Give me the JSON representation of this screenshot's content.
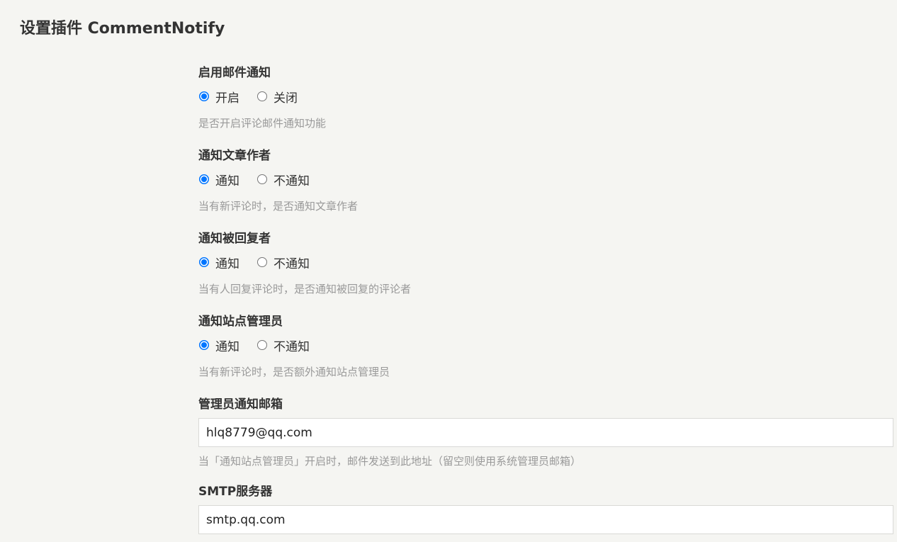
{
  "page": {
    "title": "设置插件 CommentNotify"
  },
  "fields": {
    "enable_mail": {
      "label": "启用邮件通知",
      "options": [
        "开启",
        "关闭"
      ],
      "selected": "开启",
      "hint": "是否开启评论邮件通知功能"
    },
    "notify_author": {
      "label": "通知文章作者",
      "options": [
        "通知",
        "不通知"
      ],
      "selected": "通知",
      "hint": "当有新评论时，是否通知文章作者"
    },
    "notify_replied": {
      "label": "通知被回复者",
      "options": [
        "通知",
        "不通知"
      ],
      "selected": "通知",
      "hint": "当有人回复评论时，是否通知被回复的评论者"
    },
    "notify_admin": {
      "label": "通知站点管理员",
      "options": [
        "通知",
        "不通知"
      ],
      "selected": "通知",
      "hint": "当有新评论时，是否额外通知站点管理员"
    },
    "admin_email": {
      "label": "管理员通知邮箱",
      "value": "hlq8779@qq.com",
      "hint": "当「通知站点管理员」开启时，邮件发送到此地址（留空则使用系统管理员邮箱）"
    },
    "smtp_server": {
      "label": "SMTP服务器",
      "value": "smtp.qq.com"
    }
  },
  "colors": {
    "background": "#f5f5f2",
    "accent": "#0075ff",
    "hint": "#999999"
  }
}
